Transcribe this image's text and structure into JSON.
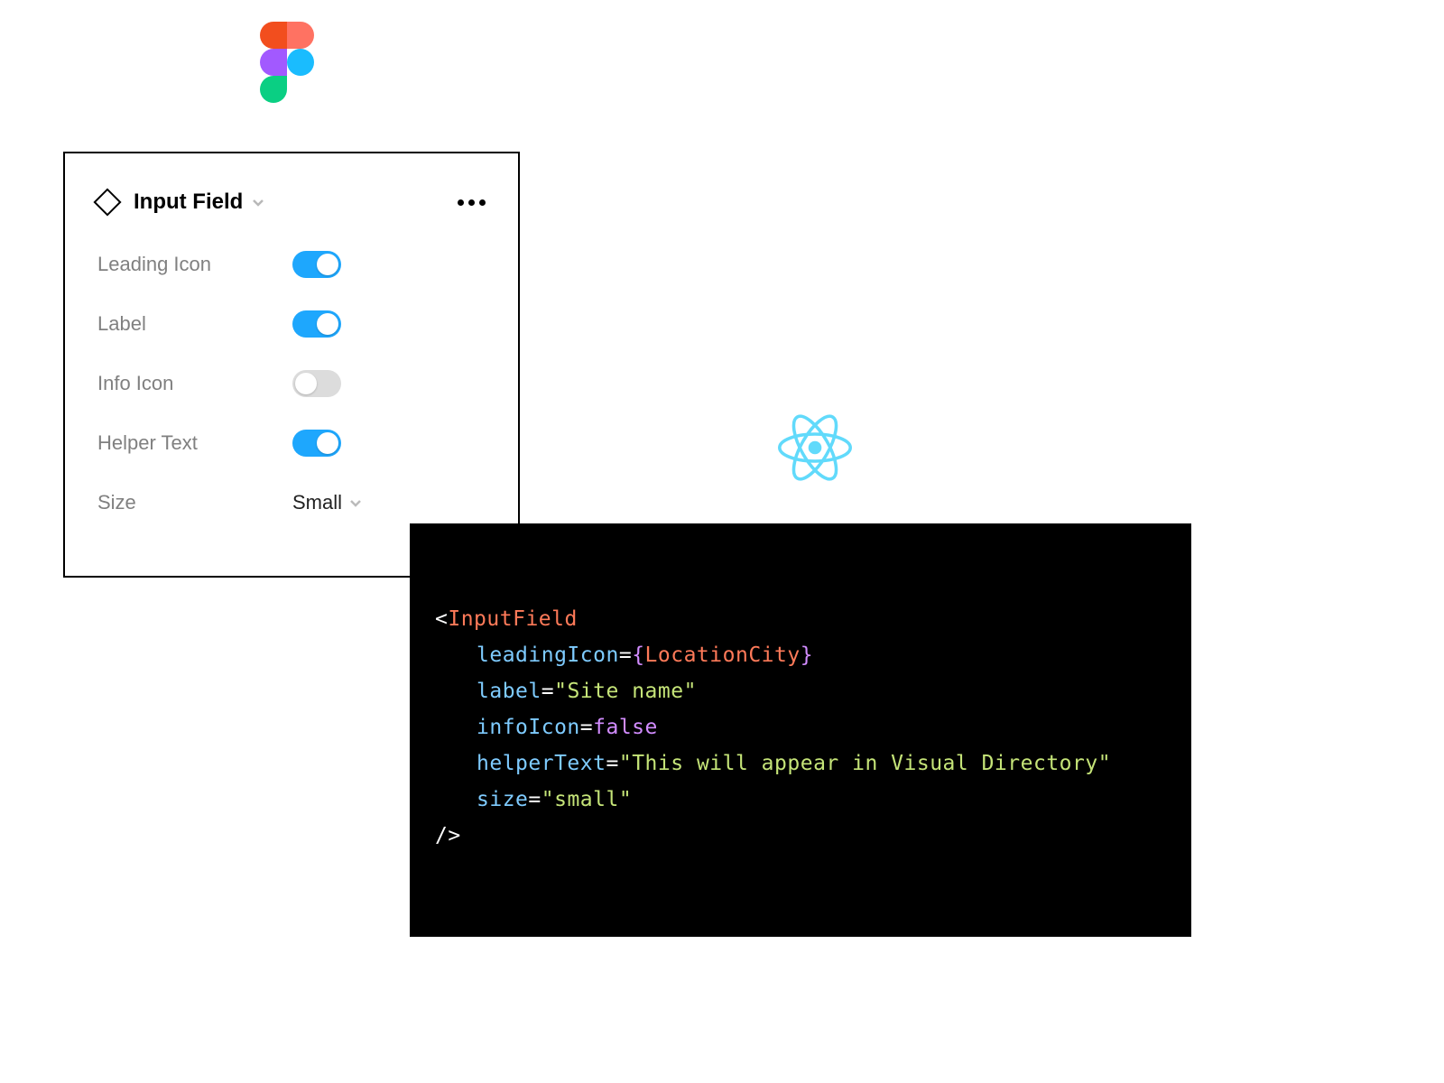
{
  "panel": {
    "title": "Input Field",
    "props": {
      "leadingIcon": {
        "label": "Leading Icon",
        "on": true
      },
      "label": {
        "label": "Label",
        "on": true
      },
      "infoIcon": {
        "label": "Info Icon",
        "on": false
      },
      "helperText": {
        "label": "Helper Text",
        "on": true
      },
      "size": {
        "label": "Size",
        "value": "Small"
      }
    }
  },
  "code": {
    "component": "InputField",
    "attrs": {
      "leadingIcon": {
        "name": "leadingIcon",
        "identifier": "LocationCity"
      },
      "label": {
        "name": "label",
        "string": "Site name"
      },
      "infoIcon": {
        "name": "infoIcon",
        "bool": "false"
      },
      "helperText": {
        "name": "helperText",
        "string": "This will appear in Visual Directory"
      },
      "size": {
        "name": "size",
        "string": "small"
      }
    }
  },
  "icons": {
    "figma": "figma-logo",
    "react": "react-logo"
  }
}
